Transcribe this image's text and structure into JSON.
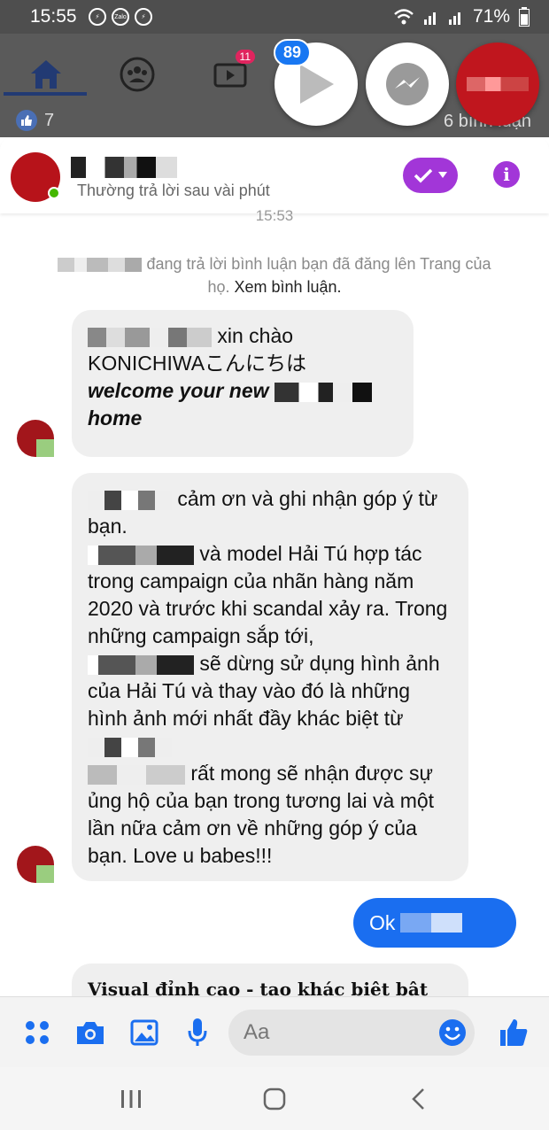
{
  "status_bar": {
    "time": "15:55",
    "battery": "71%",
    "apps": [
      "Zalo"
    ]
  },
  "facebook": {
    "tabs": [
      {
        "icon": "home-icon"
      },
      {
        "icon": "groups-icon"
      },
      {
        "icon": "watch-icon",
        "badge": "11"
      }
    ],
    "likes": "7",
    "comments": "6 bình luận"
  },
  "chat_heads": {
    "badge": "89"
  },
  "chat_header": {
    "subtitle": "Thường trả lời sau vài phút"
  },
  "time_divider": "15:53",
  "system_note": {
    "text": "đang trả lời bình luận bạn đã đăng lên Trang của họ.",
    "link": "Xem bình luận."
  },
  "messages": {
    "m1": {
      "part1": "xin chào",
      "part2": "KONICHIWAこんにちは",
      "part3": "welcome your new",
      "part4": "home"
    },
    "m2": {
      "l1": "cảm ơn và ghi nhận góp ý từ bạn.",
      "l2": "và model Hải Tú hợp tác trong campaign của nhãn hàng năm 2020 và trước khi scandal xảy ra. Trong những campaign sắp tới,",
      "l3": "sẽ dừng sử dụng hình ảnh của Hải Tú và thay vào đó là những hình ảnh mới nhất đầy khác biệt từ",
      "l4": "rất mong sẽ nhận được sự ủng hộ của bạn trong tương lai và một lần nữa cảm ơn về những góp ý của bạn. Love u babes!!!"
    },
    "sent": {
      "text": "Ok"
    },
    "m3": {
      "text": "Visual đỉnh cao - tạo khác biệt bật"
    }
  },
  "composer": {
    "placeholder": "Aa"
  },
  "colors": {
    "messenger_blue": "#1a6ef0",
    "purple": "#a236d8",
    "bubble_gray": "#efefef"
  }
}
